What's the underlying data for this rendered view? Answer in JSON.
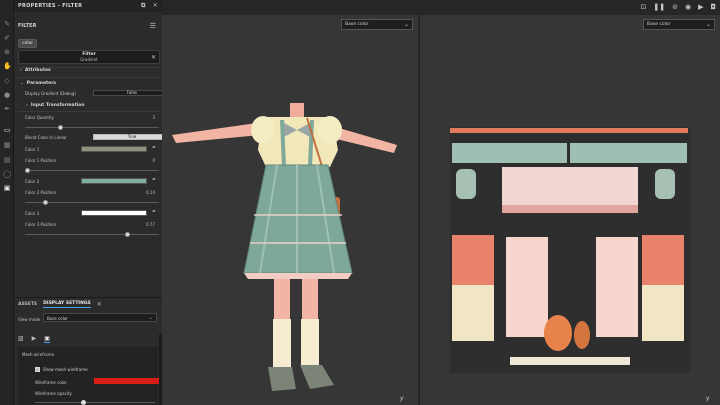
{
  "panel": {
    "title": "PROPERTIES - FILTER",
    "filter_heading": "FILTER",
    "chip": "color",
    "filter_box": {
      "title": "Filter",
      "name": "Gradient"
    },
    "sections": {
      "attributes": "Attributes",
      "parameters": "Parameters",
      "input_transformation": "Input Transformation"
    },
    "display_gradient": {
      "label": "Display Gradient (Debug)",
      "value": "False"
    },
    "color_quantity": {
      "label": "Color Quantity",
      "value": "3",
      "fraction": 0.25
    },
    "blend_linear": {
      "label": "Blend Color In Linear",
      "value": "True"
    },
    "colors": [
      {
        "label": "Color 1",
        "hex": "#8c957c",
        "pos_label": "Color 1 Position",
        "pos_value": "0",
        "fraction": 0.0
      },
      {
        "label": "Color 2",
        "hex": "#7fada0",
        "pos_label": "Color 2 Position",
        "pos_value": "0.14",
        "fraction": 0.14
      },
      {
        "label": "Color 3",
        "hex": "#ffffff",
        "pos_label": "Color 3 Position",
        "pos_value": "0.77",
        "fraction": 0.77
      }
    ]
  },
  "bottom": {
    "tabs": [
      "ASSETS",
      "DISPLAY SETTINGS"
    ],
    "view_mode_label": "View mode",
    "view_mode_value": "Base color",
    "mesh_wireframe_title": "Mesh wireframe",
    "show_mesh_wireframe": "Show mesh wireframe",
    "wireframe_color_label": "Wireframe color",
    "wireframe_color": "#d91e18",
    "wireframe_opacity_label": "Wireframe opacity",
    "wireframe_opacity_fraction": 0.4
  },
  "viewport3d": {
    "channel": "Base color",
    "axis_label": "y"
  },
  "viewport2d": {
    "channel": "Base color",
    "axis_label": "y"
  },
  "colors": {
    "accent": "#4aa3ff",
    "skin": "#f3b7a3",
    "plaid": "#7ea89a",
    "shirt": "#f1e7b8"
  }
}
